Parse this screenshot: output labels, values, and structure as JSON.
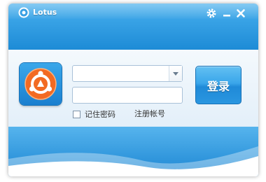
{
  "window": {
    "title": "Lotus",
    "controls": {
      "settings_icon": "gear-icon",
      "minimize_icon": "minimize-icon",
      "close_icon": "close-icon"
    }
  },
  "login": {
    "account_value": "",
    "password_value": "",
    "remember_label": "记住密码",
    "register_label": "注册帐号",
    "login_button_label": "登录"
  },
  "colors": {
    "title_bar": "#2b98e0",
    "accent": "#1d8bd6",
    "logo_orange": "#f26a22",
    "panel_bg": "#e6f1fa"
  }
}
